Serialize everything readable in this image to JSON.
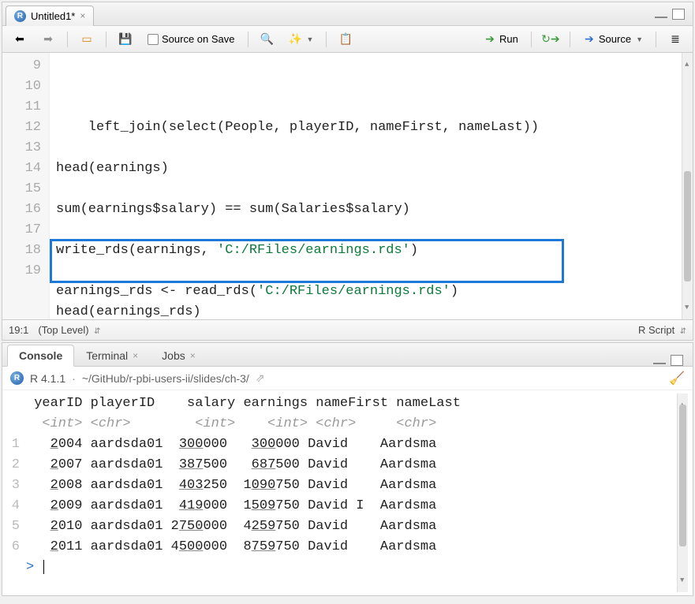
{
  "source": {
    "tab_title": "Untitled1*",
    "toolbar": {
      "source_on_save": "Source on Save",
      "run": "Run",
      "source_btn": "Source"
    },
    "status": {
      "position": "19:1",
      "scope": "(Top Level)",
      "filetype": "R Script"
    },
    "code_lines": [
      {
        "n": 9,
        "indent": "    ",
        "plain_a": "left_join(select(People, playerID, nameFirst, nameLast))"
      },
      {
        "n": 10,
        "plain": ""
      },
      {
        "n": 11,
        "plain": "head(earnings)"
      },
      {
        "n": 12,
        "plain": ""
      },
      {
        "n": 13,
        "plain": "sum(earnings$salary) == sum(Salaries$salary)"
      },
      {
        "n": 14,
        "plain": ""
      },
      {
        "n": 15,
        "call_a": "write_rds(earnings, ",
        "str": "'C:/RFiles/earnings.rds'",
        "call_b": ")"
      },
      {
        "n": 16,
        "plain": ""
      },
      {
        "n": 17,
        "call_a": "earnings_rds <- read_rds(",
        "str": "'C:/RFiles/earnings.rds'",
        "call_b": ")"
      },
      {
        "n": 18,
        "plain": "head(earnings_rds)"
      },
      {
        "n": 19,
        "plain": ""
      }
    ]
  },
  "console": {
    "tabs": {
      "console": "Console",
      "terminal": "Terminal",
      "jobs": "Jobs"
    },
    "r_version": "R 4.1.1",
    "wd": "~/GitHub/r-pbi-users-ii/slides/ch-3/",
    "header": " yearID playerID    salary earnings nameFirst nameLast",
    "types": "  <int> <chr>        <int>    <int> <chr>     <chr>",
    "rows": [
      {
        "i": "1",
        "yu": "2",
        "yr": "004",
        "pid": "aardsda01",
        "su": "300",
        "sr": "000",
        "eu": "300",
        "er": "000",
        "fn": "David  ",
        "ln": "Aardsma"
      },
      {
        "i": "2",
        "yu": "2",
        "yr": "007",
        "pid": "aardsda01",
        "su": "387",
        "sr": "500",
        "eu": "687",
        "er": "500",
        "fn": "David  ",
        "ln": "Aardsma"
      },
      {
        "i": "3",
        "yu": "2",
        "yr": "008",
        "pid": "aardsda01",
        "su": "403",
        "sr": "250",
        "eu": "090",
        "e_pre": "1",
        "er": "750",
        "fn": "David  ",
        "ln": "Aardsma"
      },
      {
        "i": "4",
        "yu": "2",
        "yr": "009",
        "pid": "aardsda01",
        "su": "419",
        "sr": "000",
        "eu": "509",
        "e_pre": "1",
        "er": "750",
        "fn": "David I",
        "ln": "Aardsma"
      },
      {
        "i": "5",
        "yu": "2",
        "yr": "010",
        "pid": "aardsda01",
        "s_pre": "2",
        "su": "750",
        "sr": "000",
        "eu": "259",
        "e_pre": "4",
        "er": "750",
        "fn": "David  ",
        "ln": "Aardsma"
      },
      {
        "i": "6",
        "yu": "2",
        "yr": "011",
        "pid": "aardsda01",
        "s_pre": "4",
        "su": "500",
        "sr": "000",
        "eu": "759",
        "e_pre": "8",
        "er": "750",
        "fn": "David  ",
        "ln": "Aardsma"
      }
    ],
    "prompt": ">"
  }
}
